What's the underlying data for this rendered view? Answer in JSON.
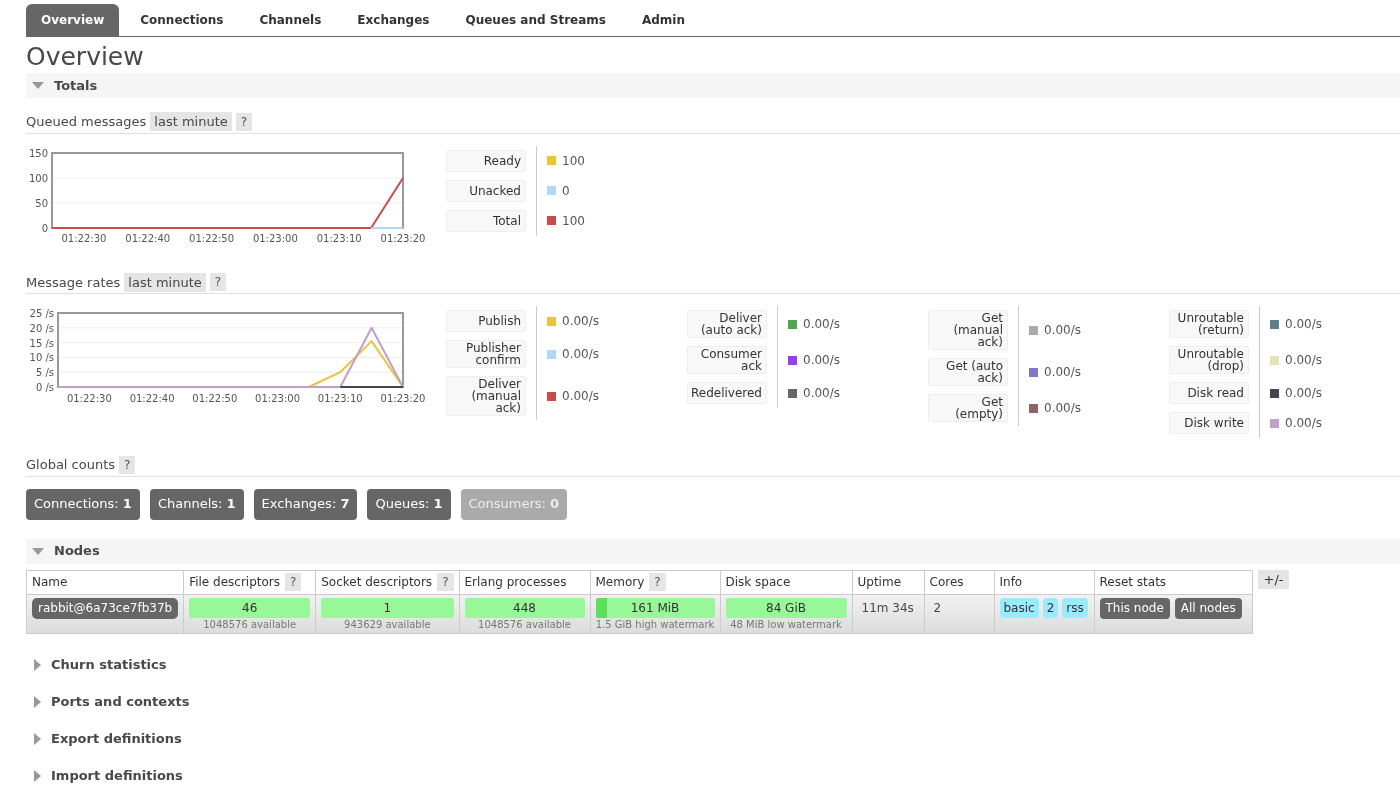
{
  "tabs": [
    {
      "label": "Overview",
      "selected": true
    },
    {
      "label": "Connections",
      "selected": false
    },
    {
      "label": "Channels",
      "selected": false
    },
    {
      "label": "Exchanges",
      "selected": false
    },
    {
      "label": "Queues and Streams",
      "selected": false
    },
    {
      "label": "Admin",
      "selected": false
    }
  ],
  "page_title": "Overview",
  "totals": {
    "title": "Totals",
    "expanded": true,
    "queued": {
      "label": "Queued messages",
      "range": "last minute",
      "help": "?",
      "chart_data": {
        "type": "line",
        "categories": [
          null,
          "01:22:30",
          null,
          "01:22:40",
          null,
          "01:22:50",
          null,
          "01:23:00",
          null,
          "01:23:10",
          null,
          "01:23:20"
        ],
        "ylim": [
          0,
          150
        ],
        "grid": true,
        "yticks": [
          0,
          50,
          100,
          150
        ],
        "series": [
          {
            "color": "#cb4b4b",
            "values": [
              0,
              0,
              0,
              0,
              0,
              0,
              0,
              0,
              0,
              0,
              0,
              100
            ]
          },
          {
            "color": "#afd8f8",
            "values": [
              null,
              null,
              null,
              null,
              null,
              null,
              null,
              null,
              null,
              null,
              0,
              0
            ]
          }
        ]
      },
      "legend": [
        {
          "label": "Ready",
          "color": "#edc240",
          "value": "100"
        },
        {
          "label": "Unacked",
          "color": "#afd8f8",
          "value": "0"
        },
        {
          "label": "Total",
          "color": "#cb4b4b",
          "value": "100"
        }
      ]
    },
    "rates": {
      "label": "Message rates",
      "range": "last minute",
      "help": "?",
      "chart_data": {
        "type": "line",
        "categories": [
          null,
          "01:22:30",
          null,
          "01:22:40",
          null,
          "01:22:50",
          null,
          "01:23:00",
          null,
          "01:23:10",
          null,
          "01:23:20"
        ],
        "ylim": [
          0,
          25
        ],
        "grid": true,
        "yticks": [
          {
            "value": 0,
            "label": "0 /s"
          },
          {
            "value": 5,
            "label": "5 /s"
          },
          {
            "value": 10,
            "label": "10 /s"
          },
          {
            "value": 15,
            "label": "15 /s"
          },
          {
            "value": 20,
            "label": "20 /s"
          },
          {
            "value": 25,
            "label": "25 /s"
          }
        ],
        "series": [
          {
            "color": "#edc240",
            "values": [
              null,
              null,
              null,
              null,
              null,
              null,
              null,
              null,
              0,
              5,
              15.5,
              0
            ]
          },
          {
            "color": "#bfa0c9",
            "values": [
              0,
              0,
              0,
              0,
              0,
              0,
              0,
              0,
              0,
              0,
              20,
              0
            ]
          },
          {
            "color": "#444450",
            "values": [
              null,
              null,
              null,
              null,
              null,
              null,
              null,
              null,
              null,
              0,
              0,
              0
            ]
          }
        ]
      },
      "legend_columns": [
        {
          "items": [
            {
              "label": "Publish",
              "color": "#edc240",
              "value": "0.00/s"
            },
            {
              "label": "Publisher confirm",
              "color": "#afd8f8",
              "value": "0.00/s"
            },
            {
              "label": "Deliver (manual ack)",
              "color": "#cb4b4b",
              "value": "0.00/s"
            }
          ]
        },
        {
          "items": [
            {
              "label": "Deliver (auto ack)",
              "color": "#4da74d",
              "value": "0.00/s"
            },
            {
              "label": "Consumer ack",
              "color": "#9440ed",
              "value": "0.00/s"
            },
            {
              "label": "Redelivered",
              "color": "#666666",
              "value": "0.00/s"
            }
          ]
        },
        {
          "items": [
            {
              "label": "Get (manual ack)",
              "color": "#aaaaaa",
              "value": "0.00/s"
            },
            {
              "label": "Get (auto ack)",
              "color": "#7c79c9",
              "value": "0.00/s"
            },
            {
              "label": "Get (empty)",
              "color": "#8d6363",
              "value": "0.00/s"
            }
          ]
        },
        {
          "items": [
            {
              "label": "Unroutable (return)",
              "color": "#607d8b",
              "value": "0.00/s"
            },
            {
              "label": "Unroutable (drop)",
              "color": "#e4e4b0",
              "value": "0.00/s"
            },
            {
              "label": "Disk read",
              "color": "#444450",
              "value": "0.00/s"
            },
            {
              "label": "Disk write",
              "color": "#bfa0c9",
              "value": "0.00/s"
            }
          ]
        }
      ]
    },
    "global_counts": {
      "label": "Global counts",
      "help": "?",
      "counts": [
        {
          "label": "Connections:",
          "value": "1",
          "disabled": false
        },
        {
          "label": "Channels:",
          "value": "1",
          "disabled": false
        },
        {
          "label": "Exchanges:",
          "value": "7",
          "disabled": false
        },
        {
          "label": "Queues:",
          "value": "1",
          "disabled": false
        },
        {
          "label": "Consumers:",
          "value": "0",
          "disabled": true
        }
      ]
    }
  },
  "nodes": {
    "title": "Nodes",
    "expanded": true,
    "columns": [
      {
        "label": "Name"
      },
      {
        "label": "File descriptors",
        "help": "?"
      },
      {
        "label": "Socket descriptors",
        "help": "?"
      },
      {
        "label": "Erlang processes"
      },
      {
        "label": "Memory",
        "help": "?"
      },
      {
        "label": "Disk space"
      },
      {
        "label": "Uptime"
      },
      {
        "label": "Cores"
      },
      {
        "label": "Info"
      },
      {
        "label": "Reset stats"
      }
    ],
    "toggle": "+/-",
    "row": [
      {
        "kind": "node",
        "value": "rabbit@6a73ce7fb37b"
      },
      {
        "kind": "bar",
        "value": "46",
        "note": "1048576 available"
      },
      {
        "kind": "bar",
        "value": "1",
        "note": "943629 available"
      },
      {
        "kind": "bar",
        "value": "448",
        "note": "1048576 available"
      },
      {
        "kind": "bar",
        "value": "161 MiB",
        "note": "1.5 GiB high watermark",
        "level": 0.1
      },
      {
        "kind": "bar",
        "value": "84 GiB",
        "note": "48 MiB low watermark"
      },
      {
        "kind": "text",
        "value": "11m 34s"
      },
      {
        "kind": "text",
        "value": "2"
      },
      {
        "kind": "badges",
        "values": [
          "basic",
          "2",
          "rss"
        ]
      },
      {
        "kind": "buttons",
        "values": [
          "This node",
          "All nodes"
        ]
      }
    ]
  },
  "sections": [
    {
      "title": "Churn statistics",
      "expanded": false
    },
    {
      "title": "Ports and contexts",
      "expanded": false
    },
    {
      "title": "Export definitions",
      "expanded": false
    },
    {
      "title": "Import definitions",
      "expanded": false
    }
  ]
}
